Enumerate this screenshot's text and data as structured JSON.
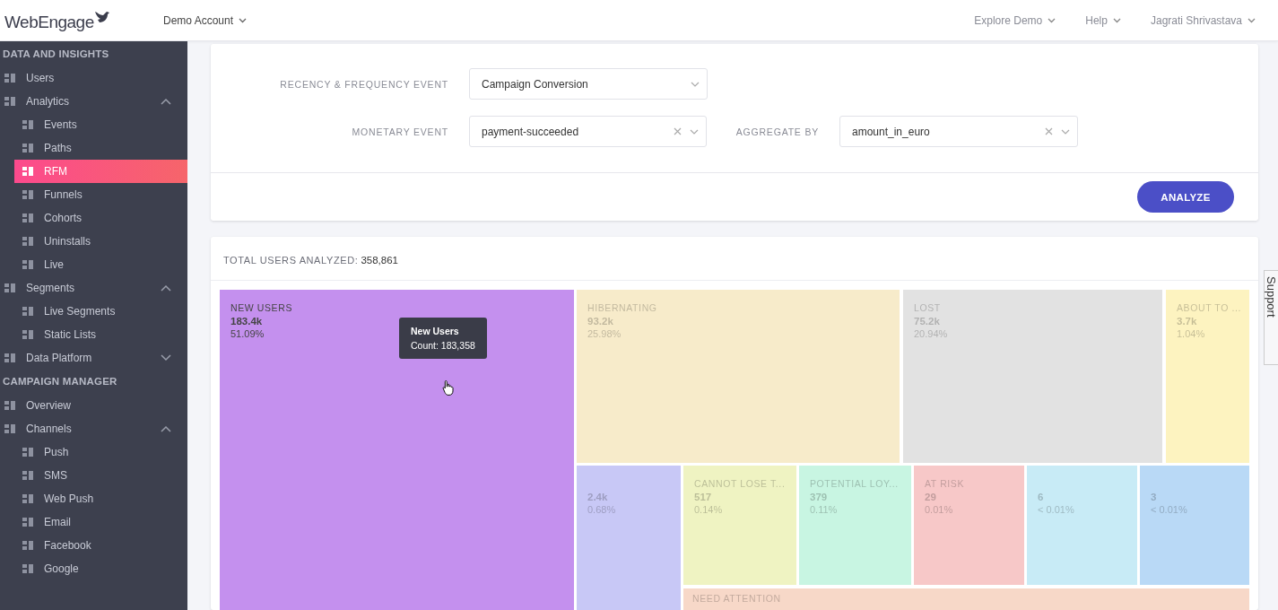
{
  "header": {
    "logo": "WebEngage",
    "account": "Demo Account",
    "menus": [
      "Explore Demo",
      "Help",
      "Jagrati Shrivastava"
    ]
  },
  "sidebar": {
    "sections": [
      {
        "title": "DATA AND INSIGHTS",
        "items": [
          {
            "label": "Users",
            "selected": false
          },
          {
            "label": "Analytics",
            "selected": false,
            "expanded": true,
            "children": [
              {
                "label": "Events",
                "selected": false
              },
              {
                "label": "Paths",
                "selected": false
              },
              {
                "label": "RFM",
                "selected": true
              },
              {
                "label": "Funnels",
                "selected": false
              },
              {
                "label": "Cohorts",
                "selected": false
              },
              {
                "label": "Uninstalls",
                "selected": false
              },
              {
                "label": "Live",
                "selected": false
              }
            ]
          },
          {
            "label": "Segments",
            "selected": false,
            "expanded": true,
            "children": [
              {
                "label": "Live Segments",
                "selected": false
              },
              {
                "label": "Static Lists",
                "selected": false
              }
            ]
          },
          {
            "label": "Data Platform",
            "selected": false,
            "expanded": false
          }
        ]
      },
      {
        "title": "CAMPAIGN MANAGER",
        "items": [
          {
            "label": "Overview",
            "selected": false
          },
          {
            "label": "Channels",
            "selected": false,
            "expanded": true,
            "children": [
              {
                "label": "Push",
                "selected": false
              },
              {
                "label": "SMS",
                "selected": false
              },
              {
                "label": "Web Push",
                "selected": false
              },
              {
                "label": "Email",
                "selected": false
              },
              {
                "label": "Facebook",
                "selected": false
              },
              {
                "label": "Google",
                "selected": false
              }
            ]
          }
        ]
      }
    ]
  },
  "form": {
    "rows": [
      [
        {
          "label": "RECENCY & FREQUENCY EVENT",
          "value": "Campaign Conversion",
          "clearable": false
        }
      ],
      [
        {
          "label": "MONETARY EVENT",
          "value": "payment-succeeded",
          "clearable": true
        },
        {
          "label": "AGGREGATE BY",
          "value": "amount_in_euro",
          "clearable": true
        }
      ]
    ],
    "button": "ANALYZE"
  },
  "results": {
    "total_label": "TOTAL USERS ANALYZED:",
    "total_value": "358,861",
    "tiles": [
      {
        "label": "NEW USERS",
        "value": "183.4k",
        "percent": "51.09%",
        "color": "#c490ee",
        "dimmed": false
      },
      {
        "label": "HIBERNATING",
        "value": "93.2k",
        "percent": "25.98%",
        "color": "#f7ebca",
        "dimmed": true
      },
      {
        "label": "LOST",
        "value": "75.2k",
        "percent": "20.94%",
        "color": "#e2e2e2",
        "dimmed": true
      },
      {
        "label": "ABOUT TO ...",
        "value": "3.7k",
        "percent": "1.04%",
        "color": "#fdf3c0",
        "dimmed": true
      },
      {
        "value": "2.4k",
        "percent": "0.68%",
        "color": "#c8c8f6",
        "dimmed": true
      },
      {
        "label": "CANNOT LOSE T...",
        "value": "517",
        "percent": "0.14%",
        "color": "#eff3c2",
        "dimmed": true
      },
      {
        "label": "POTENTIAL LOY...",
        "value": "379",
        "percent": "0.11%",
        "color": "#c8f5e2",
        "dimmed": true
      },
      {
        "label": "AT RISK",
        "value": "29",
        "percent": "0.01%",
        "color": "#f7c8c8",
        "dimmed": true
      },
      {
        "value": "6",
        "percent": "< 0.01%",
        "color": "#c8ebf6",
        "dimmed": true
      },
      {
        "value": "3",
        "percent": "< 0.01%",
        "color": "#b9d9f6",
        "dimmed": true
      },
      {
        "label": "NEED ATTENTION",
        "color": "#f7d8c8",
        "dimmed": true
      }
    ],
    "tooltip": {
      "title": "New Users",
      "text": "Count: 183,358"
    }
  },
  "support_tab": "Support"
}
